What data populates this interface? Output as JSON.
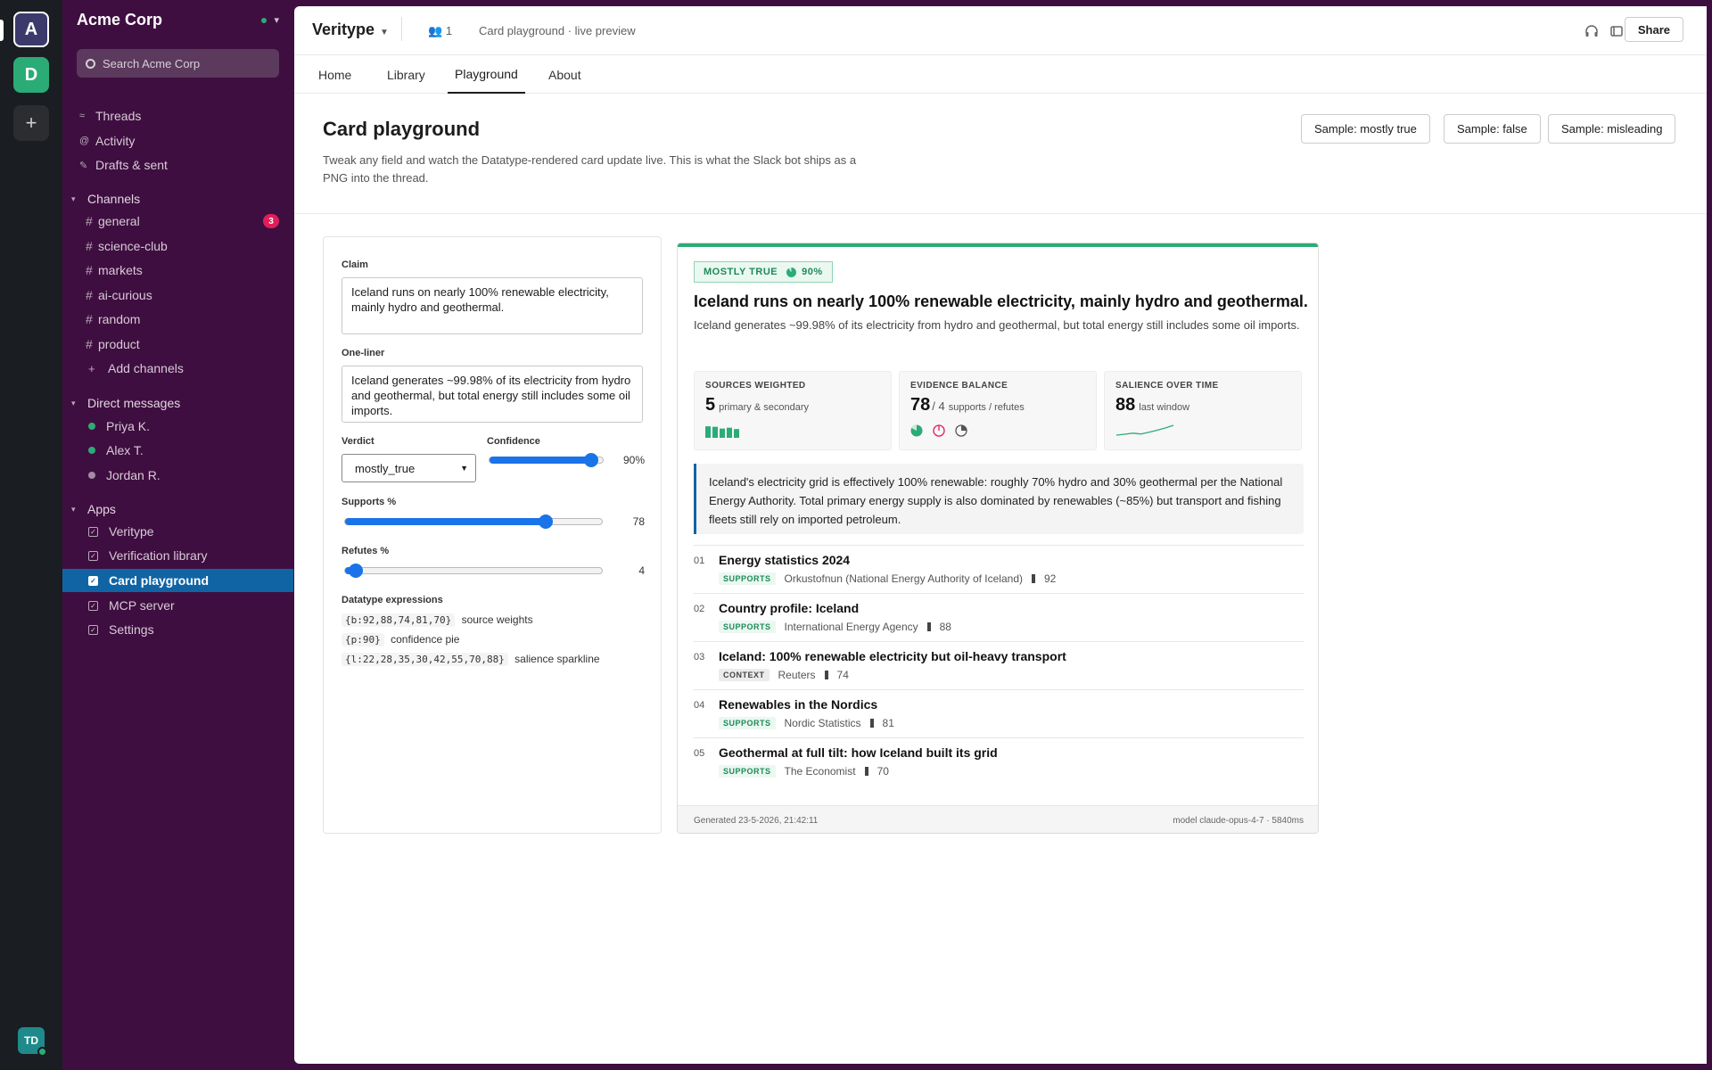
{
  "rail": {
    "workspaces": [
      "A",
      "D"
    ],
    "add_label": "+",
    "user_initials": "TD"
  },
  "sidebar": {
    "workspace_name": "Acme Corp",
    "search_placeholder": "Search Acme Corp",
    "nav": [
      {
        "label": "Threads",
        "icon": "threads-icon"
      },
      {
        "label": "Activity",
        "icon": "at-icon"
      },
      {
        "label": "Drafts & sent",
        "icon": "pencil-icon"
      }
    ],
    "channels_header": "Channels",
    "channels": [
      {
        "name": "general",
        "badge": "3"
      },
      {
        "name": "science-club"
      },
      {
        "name": "markets"
      },
      {
        "name": "ai-curious"
      },
      {
        "name": "random"
      },
      {
        "name": "product"
      }
    ],
    "add_channels": "Add channels",
    "dm_header": "Direct messages",
    "dms": [
      {
        "name": "Priya K.",
        "status": "online",
        "color": "#2bac76"
      },
      {
        "name": "Alex T.",
        "status": "online",
        "color": "#2bac76"
      },
      {
        "name": "Jordan R.",
        "status": "away",
        "color": "#a58aa5"
      }
    ],
    "apps_header": "Apps",
    "apps": [
      {
        "name": "Veritype"
      },
      {
        "name": "Verification library"
      },
      {
        "name": "Card playground",
        "active": true
      },
      {
        "name": "MCP server"
      },
      {
        "name": "Settings"
      }
    ]
  },
  "topbar": {
    "app_name": "Veritype",
    "members": "1",
    "subtitle": "Card playground · live preview",
    "share_label": "Share"
  },
  "tabs": [
    "Home",
    "Library",
    "Playground",
    "About"
  ],
  "active_tab": "Playground",
  "page": {
    "title": "Card playground",
    "description": "Tweak any field and watch the Datatype-rendered card update live. This is what the Slack bot ships as a PNG into the thread.",
    "samples": [
      "Sample: mostly true",
      "Sample: false",
      "Sample: misleading"
    ]
  },
  "editor": {
    "claim_label": "Claim",
    "claim_value": "Iceland runs on nearly 100% renewable electricity, mainly hydro and geothermal.",
    "oneliner_label": "One-liner",
    "oneliner_value": "Iceland generates ~99.98% of its electricity from hydro and geothermal, but total energy still includes some oil imports.",
    "verdict_label": "Verdict",
    "verdict_value": "mostly_true",
    "confidence_label": "Confidence",
    "confidence_value": 90,
    "confidence_display": "90%",
    "supports_label": "Supports %",
    "supports_value": 78,
    "supports_display": "78",
    "refutes_label": "Refutes %",
    "refutes_value": 4,
    "refutes_display": "4",
    "expressions_label": "Datatype expressions",
    "expressions": [
      {
        "code": "{b:92,88,74,81,70}",
        "desc": "source weights"
      },
      {
        "code": "{p:90}",
        "desc": "confidence pie"
      },
      {
        "code": "{l:22,28,35,30,42,55,70,88}",
        "desc": "salience sparkline"
      }
    ]
  },
  "card": {
    "accent": "#2bac76",
    "verdict_badge": "MOSTLY TRUE",
    "verdict_pct": "90%",
    "title": "Iceland runs on nearly 100% renewable electricity, mainly hydro and geothermal.",
    "subtitle": "Iceland generates ~99.98% of its electricity from hydro and geothermal, but total energy still includes some oil imports.",
    "stats": [
      {
        "header": "SOURCES WEIGHTED",
        "big": "5",
        "small": "primary & secondary",
        "bars": [
          92,
          88,
          74,
          81,
          70
        ]
      },
      {
        "header": "EVIDENCE BALANCE",
        "big": "78",
        "slash": "/ 4",
        "small": "supports / refutes"
      },
      {
        "header": "SALIENCE OVER TIME",
        "big": "88",
        "small": "last window",
        "spark": [
          22,
          28,
          35,
          30,
          42,
          55,
          70,
          88
        ]
      }
    ],
    "quote": "Iceland's electricity grid is effectively 100% renewable: roughly 70% hydro and 30% geothermal per the National Energy Authority. Total primary energy supply is also dominated by renewables (~85%) but transport and fishing fleets still rely on imported petroleum.",
    "sources": [
      {
        "num": "01",
        "title": "Energy statistics 2024",
        "tag": "SUPPORTS",
        "publisher": "Orkustofnun (National Energy Authority of Iceland)",
        "weight": "92"
      },
      {
        "num": "02",
        "title": "Country profile: Iceland",
        "tag": "SUPPORTS",
        "publisher": "International Energy Agency",
        "weight": "88"
      },
      {
        "num": "03",
        "title": "Iceland: 100% renewable electricity but oil-heavy transport",
        "tag": "CONTEXT",
        "publisher": "Reuters",
        "weight": "74"
      },
      {
        "num": "04",
        "title": "Renewables in the Nordics",
        "tag": "SUPPORTS",
        "publisher": "Nordic Statistics",
        "weight": "81"
      },
      {
        "num": "05",
        "title": "Geothermal at full tilt: how Iceland built its grid",
        "tag": "SUPPORTS",
        "publisher": "The Economist",
        "weight": "70"
      }
    ],
    "footer_left": "Generated 23-5-2026, 21:42:11",
    "footer_right": "model claude-opus-4-7 · 5840ms"
  }
}
